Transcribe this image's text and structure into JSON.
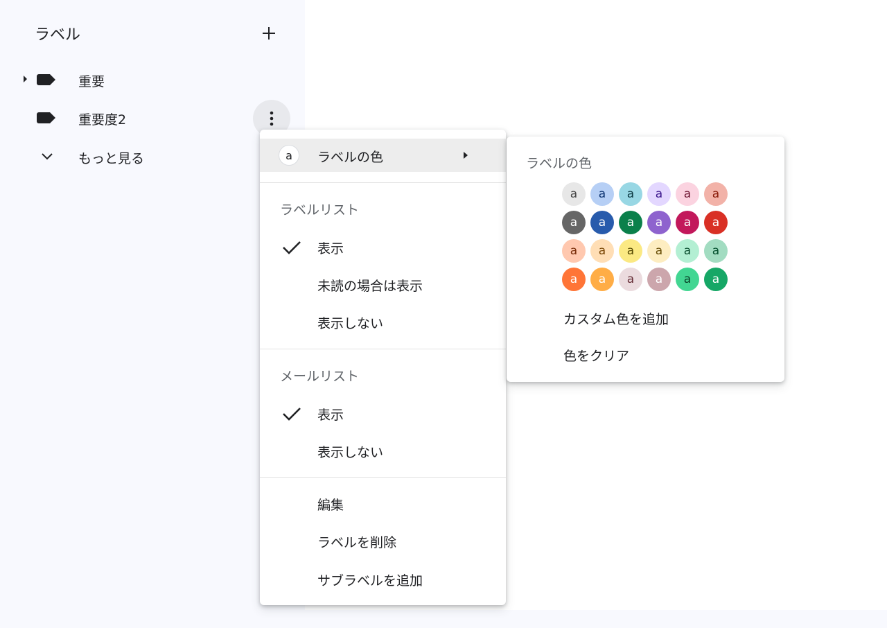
{
  "sidebar": {
    "title": "ラベル",
    "labels": [
      {
        "name": "重要",
        "has_children": true
      },
      {
        "name": "重要度2",
        "has_children": false
      }
    ],
    "more": "もっと見る"
  },
  "menu": {
    "label_color": "ラベルの色",
    "swatch_letter": "a",
    "label_list_header": "ラベルリスト",
    "label_list_options": [
      "表示",
      "未読の場合は表示",
      "表示しない"
    ],
    "mail_list_header": "メールリスト",
    "mail_list_options": [
      "表示",
      "表示しない"
    ],
    "edit": "編集",
    "delete_label": "ラベルを削除",
    "add_sublabel": "サブラベルを追加"
  },
  "color_submenu": {
    "title": "ラベルの色",
    "swatch_letter": "a",
    "colors": [
      [
        {
          "bg": "#e7e7e7",
          "fg": "#464646"
        },
        {
          "bg": "#b6cff5",
          "fg": "#0d3472"
        },
        {
          "bg": "#98d7e4",
          "fg": "#0d3b44"
        },
        {
          "bg": "#e3d7ff",
          "fg": "#3d188e"
        },
        {
          "bg": "#fbd3e0",
          "fg": "#711a36"
        },
        {
          "bg": "#f2b2a8",
          "fg": "#8a1c0a"
        }
      ],
      [
        {
          "bg": "#666666",
          "fg": "#ffffff"
        },
        {
          "bg": "#285bac",
          "fg": "#ffffff"
        },
        {
          "bg": "#0b804b",
          "fg": "#ffffff"
        },
        {
          "bg": "#8e63ce",
          "fg": "#ffffff"
        },
        {
          "bg": "#c2185b",
          "fg": "#ffffff"
        },
        {
          "bg": "#d93025",
          "fg": "#ffffff"
        }
      ],
      [
        {
          "bg": "#ffc8af",
          "fg": "#7a2e0b"
        },
        {
          "bg": "#ffdeb5",
          "fg": "#7a4706"
        },
        {
          "bg": "#fbe983",
          "fg": "#594c05"
        },
        {
          "bg": "#fdedc1",
          "fg": "#684e07"
        },
        {
          "bg": "#b3efd3",
          "fg": "#0b4f30"
        },
        {
          "bg": "#a2dcc1",
          "fg": "#04502e"
        }
      ],
      [
        {
          "bg": "#ff7537",
          "fg": "#ffffff"
        },
        {
          "bg": "#ffad46",
          "fg": "#ffffff"
        },
        {
          "bg": "#ebdbde",
          "fg": "#662e37"
        },
        {
          "bg": "#cca6ac",
          "fg": "#ffffff"
        },
        {
          "bg": "#42d692",
          "fg": "#094228"
        },
        {
          "bg": "#16a766",
          "fg": "#ffffff"
        }
      ]
    ],
    "add_custom": "カスタム色を追加",
    "clear": "色をクリア"
  }
}
